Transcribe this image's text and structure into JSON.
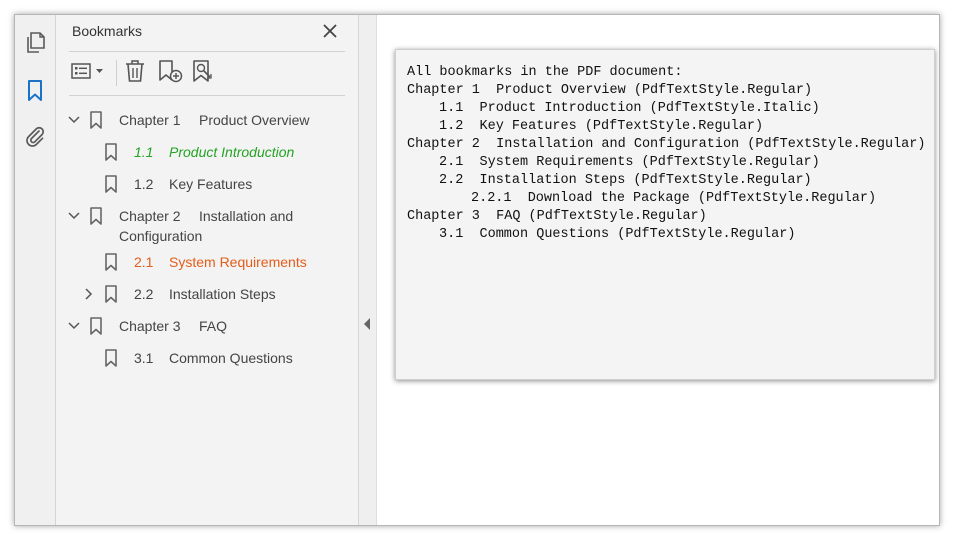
{
  "panel": {
    "title": "Bookmarks",
    "close_icon": "close-icon"
  },
  "rail": {
    "icons": [
      "pages-icon",
      "bookmark-icon",
      "attachment-icon"
    ]
  },
  "toolbar": {
    "icons": [
      "options-menu-icon",
      "delete-bookmark-icon",
      "new-bookmark-icon",
      "expand-bookmark-icon"
    ]
  },
  "tree": [
    {
      "num": "Chapter 1",
      "title": "Product Overview",
      "expanded": true
    },
    {
      "num": "1.1",
      "title": "Product Introduction",
      "style": "italic",
      "color": "#26a326"
    },
    {
      "num": "1.2",
      "title": "Key Features"
    },
    {
      "num": "Chapter 2",
      "title": "Installation and",
      "title2": "Configuration",
      "expanded": true
    },
    {
      "num": "2.1",
      "title": "System Requirements",
      "color": "#e35d1a"
    },
    {
      "num": "2.2",
      "title": "Installation Steps",
      "expanded": false
    },
    {
      "num": "Chapter 3",
      "title": "FAQ",
      "expanded": true
    },
    {
      "num": "3.1",
      "title": "Common Questions"
    }
  ],
  "document": {
    "lines": [
      "All bookmarks in the PDF document:",
      "Chapter 1  Product Overview (PdfTextStyle.Regular)",
      "1.1  Product Introduction (PdfTextStyle.Italic)",
      "1.2  Key Features (PdfTextStyle.Regular)",
      "Chapter 2  Installation and Configuration (PdfTextStyle.Regular)",
      "2.1  System Requirements (PdfTextStyle.Regular)",
      "2.2  Installation Steps (PdfTextStyle.Regular)",
      "2.2.1  Download the Package (PdfTextStyle.Regular)",
      "Chapter 3  FAQ (PdfTextStyle.Regular)",
      "3.1  Common Questions (PdfTextStyle.Regular)"
    ]
  }
}
